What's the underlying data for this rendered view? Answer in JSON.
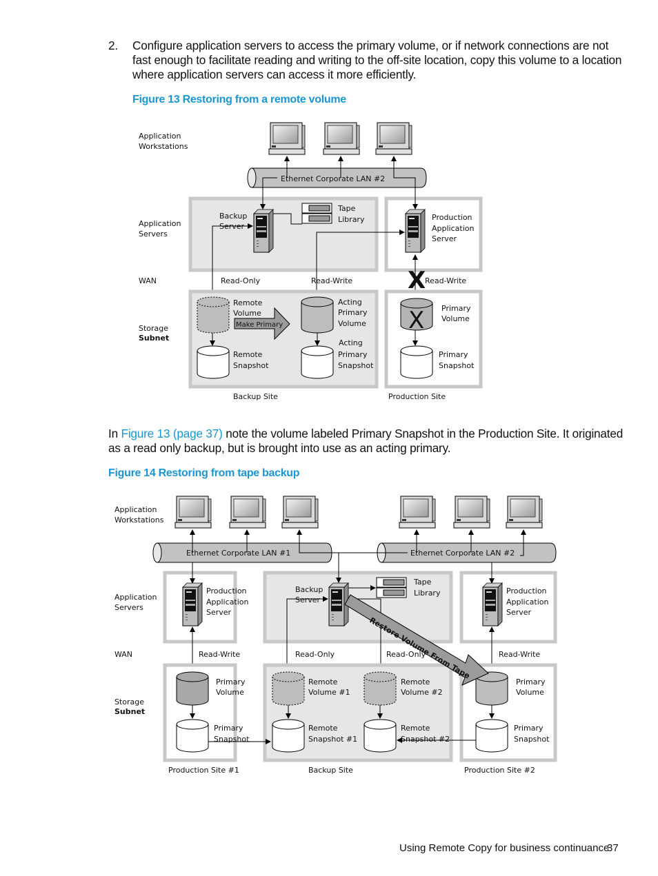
{
  "step": {
    "number": "2.",
    "text": "Configure application servers to access the primary volume, or if network connections are not fast enough to facilitate reading and writing to the off-site location, copy this volume to a location where application servers can access it more efficiently."
  },
  "figure13": {
    "caption": "Figure 13 Restoring from a remote volume",
    "row_labels": {
      "workstations_1": "Application",
      "workstations_2": "Workstations",
      "servers_1": "Application",
      "servers_2": "Servers",
      "wan": "WAN",
      "storage_1": "Storage",
      "storage_2": "Subnet"
    },
    "lan": "Ethernet Corporate LAN #2",
    "backup_server_1": "Backup",
    "backup_server_2": "Server",
    "tape_1": "Tape",
    "tape_2": "Library",
    "prod_server_1": "Production",
    "prod_server_2": "Application",
    "prod_server_3": "Server",
    "read_only": "Read-Only",
    "read_write_1": "Read-Write",
    "read_write_2": "Read-Write",
    "remote_volume_1": "Remote",
    "remote_volume_2": "Volume",
    "make_primary": "Make Primary",
    "acting_volume_1": "Acting",
    "acting_volume_2": "Primary",
    "acting_volume_3": "Volume",
    "remote_snapshot_1": "Remote",
    "remote_snapshot_2": "Snapshot",
    "acting_snapshot_1": "Acting",
    "acting_snapshot_2": "Primary",
    "acting_snapshot_3": "Snapshot",
    "primary_volume_1": "Primary",
    "primary_volume_2": "Volume",
    "primary_snapshot_1": "Primary",
    "primary_snapshot_2": "Snapshot",
    "failure_mark": "X",
    "backup_site": "Backup Site",
    "production_site": "Production Site"
  },
  "middle_para": {
    "prefix": "In ",
    "link": "Figure 13 (page 37)",
    "rest_line1": " note the volume labeled Primary Snapshot in the Production Site. It originated",
    "line2": "as a read only backup, but is brought into use as an acting primary."
  },
  "figure14": {
    "caption": "Figure 14 Restoring from tape backup",
    "row_labels": {
      "workstations_1": "Application",
      "workstations_2": "Workstations",
      "servers_1": "Application",
      "servers_2": "Servers",
      "wan": "WAN",
      "storage_1": "Storage",
      "storage_2": "Subnet"
    },
    "lan1": "Ethernet Corporate LAN #1",
    "lan2": "Ethernet Corporate LAN #2",
    "prod1_server_1": "Production",
    "prod1_server_2": "Application",
    "prod1_server_3": "Server",
    "backup_server_1": "Backup",
    "backup_server_2": "Server",
    "tape_1": "Tape",
    "tape_2": "Library",
    "prod2_server_1": "Production",
    "prod2_server_2": "Application",
    "prod2_server_3": "Server",
    "restore_arrow": "Restore Volume From Tape",
    "rw_1": "Read-Write",
    "ro_1": "Read-Only",
    "ro_2": "Read-Only",
    "rw_2": "Read-Write",
    "p1_volume_1": "Primary",
    "p1_volume_2": "Volume",
    "p1_snapshot_1": "Primary",
    "p1_snapshot_2": "Snapshot",
    "rv1_1": "Remote",
    "rv1_2": "Volume #1",
    "rs1_1": "Remote",
    "rs1_2": "Snapshot #1",
    "rv2_1": "Remote",
    "rv2_2": "Volume #2",
    "rs2_1": "Remote",
    "rs2_2": "Snapshot #2",
    "p2_volume_1": "Primary",
    "p2_volume_2": "Volume",
    "p2_snapshot_1": "Primary",
    "p2_snapshot_2": "Snapshot",
    "site1": "Production Site #1",
    "backup_site": "Backup Site",
    "site2": "Production Site #2"
  },
  "footer": {
    "section": "Using Remote Copy for business continuance",
    "page": "37"
  },
  "colors": {
    "caption_blue": "#1a96d4",
    "panel_gray": "#e6e6e6",
    "panel_border": "#c8c8c8",
    "volume_fill": "#b4b4b4"
  }
}
